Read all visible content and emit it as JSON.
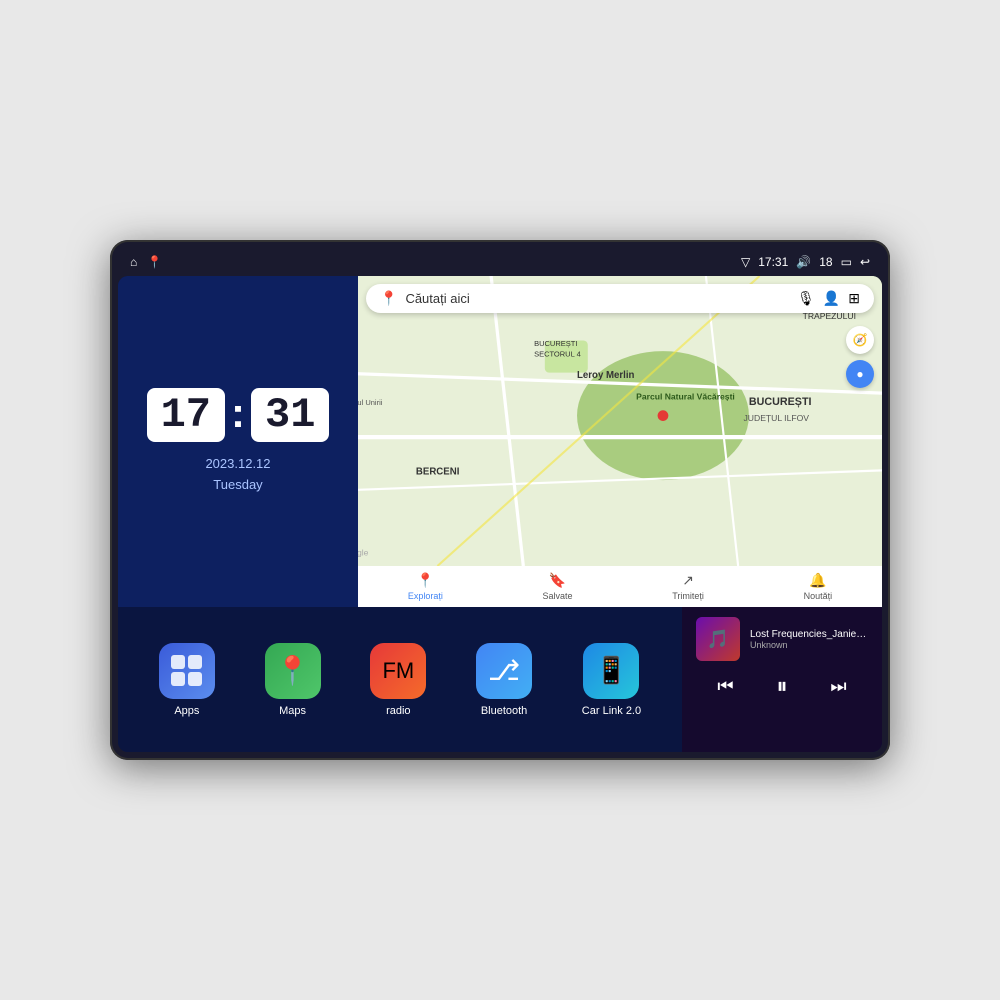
{
  "device": {
    "statusBar": {
      "leftIcons": [
        "⌂",
        "📍"
      ],
      "signal": "▽",
      "time": "17:31",
      "volume": "🔊",
      "battery_level": "18",
      "battery_icon": "🔋",
      "back": "↩"
    },
    "clock": {
      "hours": "17",
      "minutes": "31",
      "date": "2023.12.12",
      "day": "Tuesday"
    },
    "map": {
      "searchPlaceholder": "Căutați aici",
      "pin_color": "#4285f4",
      "labels": {
        "parcul": "Parcul Natural Văcărești",
        "leroy": "Leroy Merlin",
        "bucuresti": "BUCUREȘTI",
        "ilfov": "JUDEȚUL ILFOV",
        "berceni": "BERCENI",
        "trapezului": "TRAPEZULUI",
        "sector4": "BUCUREȘTI\nSECTORUL 4"
      },
      "bottomItems": [
        {
          "icon": "📍",
          "label": "Explorați",
          "active": true
        },
        {
          "icon": "🔖",
          "label": "Salvate",
          "active": false
        },
        {
          "icon": "↗",
          "label": "Trimiteți",
          "active": false
        },
        {
          "icon": "🔔",
          "label": "Noutăți",
          "active": false
        }
      ]
    },
    "apps": [
      {
        "id": "apps",
        "label": "Apps",
        "emoji": "grid"
      },
      {
        "id": "maps",
        "label": "Maps",
        "emoji": "🗺"
      },
      {
        "id": "radio",
        "label": "radio",
        "emoji": "📻"
      },
      {
        "id": "bluetooth",
        "label": "Bluetooth",
        "emoji": "🔷"
      },
      {
        "id": "carlink",
        "label": "Car Link 2.0",
        "emoji": "📱"
      }
    ],
    "music": {
      "title": "Lost Frequencies_Janieck Devy-...",
      "artist": "Unknown",
      "controls": {
        "prev": "⏮",
        "play": "⏸",
        "next": "⏭"
      }
    }
  }
}
